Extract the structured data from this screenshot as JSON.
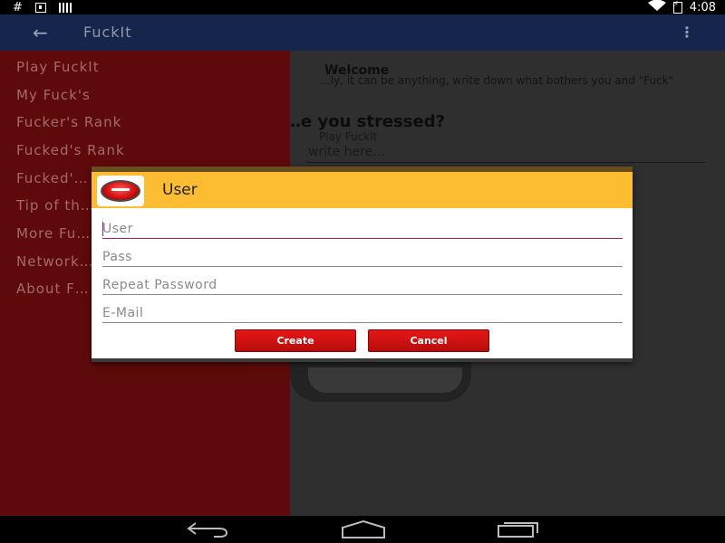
{
  "status_bar": {
    "left_glyph": "#",
    "time": "4:08",
    "icons": [
      "hash-icon",
      "download-icon",
      "signal-icon",
      "wifi-icon",
      "battery-icon"
    ]
  },
  "app_bar": {
    "title": "FuckIt",
    "back_icon": "arrow-back-icon",
    "overflow_icon": "overflow-menu-icon",
    "color": "#16254c"
  },
  "content": {
    "welcome": "Welcome",
    "intro": "…ly, it can be anything, write down what bothers you and \"Fuck\"",
    "stressed": "…e you stressed?",
    "play_link": "Play FuckIt",
    "input_placeholder": "write here..."
  },
  "drawer": {
    "color": "#5e0a0a",
    "items": [
      {
        "label": "Play FuckIt"
      },
      {
        "label": "My Fuck's"
      },
      {
        "label": "Fucker's Rank"
      },
      {
        "label": "Fucked's Rank"
      },
      {
        "label": "Fucked'…"
      },
      {
        "label": "Tip of th…"
      },
      {
        "label": "More Fu…"
      },
      {
        "label": "Network…"
      },
      {
        "label": "About F…"
      }
    ]
  },
  "dialog": {
    "title": "User",
    "header_color": "#fdbd33",
    "logo_icon": "red-button-logo-icon",
    "fields": {
      "user": {
        "placeholder": "User",
        "value": ""
      },
      "pass": {
        "placeholder": "Pass",
        "value": ""
      },
      "repeat": {
        "placeholder": "Repeat Password",
        "value": ""
      },
      "email": {
        "placeholder": "E-Mail",
        "value": ""
      }
    },
    "buttons": {
      "create": "Create",
      "cancel": "Cancel"
    },
    "button_color": "#d91313"
  },
  "nav_bar": {
    "icons": [
      "nav-back-icon",
      "nav-home-icon",
      "nav-recents-icon"
    ]
  }
}
